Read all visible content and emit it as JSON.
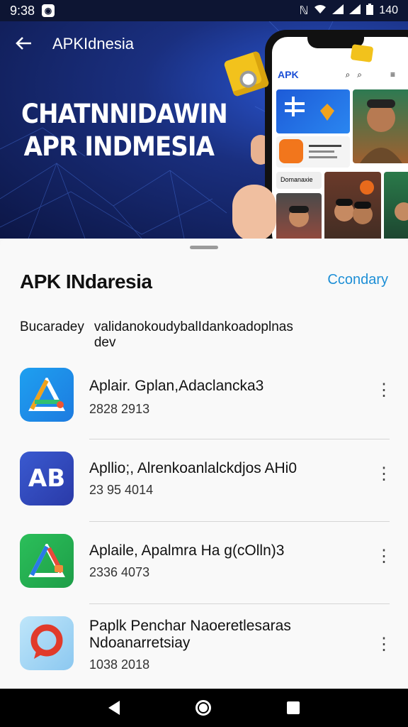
{
  "status_bar": {
    "time": "9:38",
    "battery": "140"
  },
  "hero": {
    "app_title": "APKIdnesia",
    "headline_line1": "CHATNNIDAWIN",
    "headline_line2": "APR INDMESIA",
    "phone_logo": "APK",
    "phone_tile_text": "Domanaxie"
  },
  "sheet": {
    "title": "APK INdaresia",
    "action_label": "Ccondary",
    "description_label": "Bucaradey",
    "description_text": "validanokoudybalIdankoadoplnas dev"
  },
  "apps": [
    {
      "name": "Aplair. Gplan,Adaclancka3",
      "date": "2828 2913",
      "icon": "triangle-logo-icon",
      "icon_text": ""
    },
    {
      "name": "Apllio;, Alrenkoanlalckdjos AHi0",
      "date": "23 95 4014",
      "icon": "ab-logo-icon",
      "icon_text": "AB"
    },
    {
      "name": "Aplaile, Apalmra Ha g(cOlln)3",
      "date": "2336 4073",
      "icon": "triangle-logo-icon",
      "icon_text": ""
    },
    {
      "name": "Paplk Penchar Naoeretlesaras Ndoanarretsiay",
      "date": "1038 2018",
      "icon": "map-pin-icon",
      "icon_text": ""
    }
  ],
  "colors": {
    "accent": "#1e8fd6",
    "hero_dark": "#0c1645",
    "hero_light": "#2a58d6"
  }
}
